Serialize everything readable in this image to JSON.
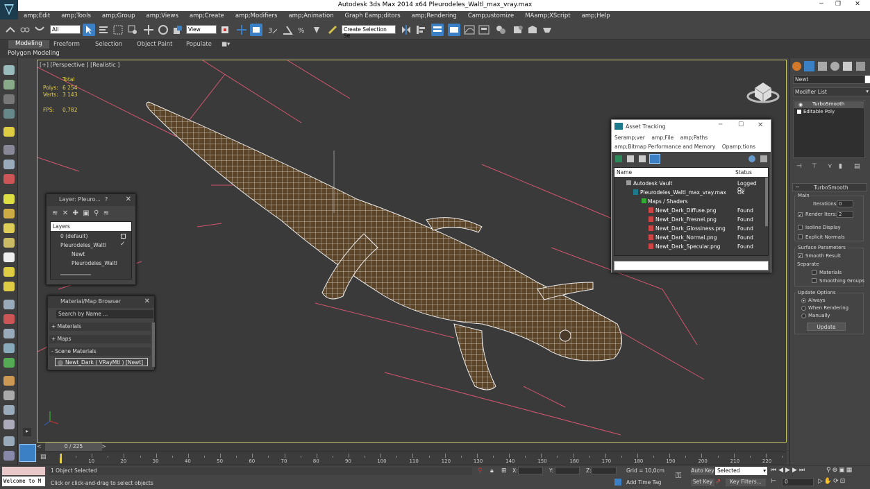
{
  "window": {
    "title": "Autodesk 3ds Max  2014 x64     Pleurodeles_Waltl_max_vray.max"
  },
  "menu": [
    "amp;Edit",
    "amp;Tools",
    "amp;Group",
    "amp;Views",
    "amp;Create",
    "amp;Modifiers",
    "amp;Animation",
    "Graph Eamp;ditors",
    "amp;Rendering",
    "Camp;ustomize",
    "MAamp;XScript",
    "amp;Help"
  ],
  "toolbar": {
    "filter_value": "All",
    "coord_value": "View",
    "selection_set_placeholder": "Create Selection Se"
  },
  "ribbon": {
    "tabs": [
      "Modeling",
      "Freeform",
      "Selection",
      "Object Paint",
      "Populate"
    ],
    "sub_label": "Polygon Modeling"
  },
  "viewport": {
    "label": "[+] [Perspective ] [Realistic ]",
    "stats": {
      "total_label": "Total",
      "polys_label": "Polys:",
      "polys_value": "6 254",
      "verts_label": "Verts:",
      "verts_value": "3 143",
      "fps_label": "FPS:",
      "fps_value": "0,782"
    }
  },
  "layer_dialog": {
    "title": "Layer: Pleuro...",
    "help": "?",
    "column": "Layers",
    "rows": [
      "0 (default)",
      "Pleurodeles_Waltl",
      "Newt",
      "Pleurodeles_Waltl"
    ]
  },
  "material_browser": {
    "title": "Material/Map Browser",
    "search_placeholder": "Search by Name ...",
    "sections": [
      "+ Materials",
      "+ Maps",
      "- Scene Materials"
    ],
    "scene_material": "Newt_Dark ( VRayMtl ) [Newt]"
  },
  "asset_tracking": {
    "title": "Asset Tracking",
    "menu1": [
      "Seramp;ver",
      "amp;File",
      "amp;Paths"
    ],
    "menu2": [
      "amp;Bitmap Performance and Memory",
      "Opamp;tions"
    ],
    "columns": [
      "Name",
      "Status"
    ],
    "rows": [
      {
        "name": "Autodesk Vault",
        "status": "Logged Ou"
      },
      {
        "name": "Pleurodeles_Waltl_max_vray.max",
        "status": "Ok"
      },
      {
        "name": "Maps / Shaders",
        "status": ""
      },
      {
        "name": "Newt_Dark_Diffuse.png",
        "status": "Found"
      },
      {
        "name": "Newt_Dark_Fresnel.png",
        "status": "Found"
      },
      {
        "name": "Newt_Dark_Glossiness.png",
        "status": "Found"
      },
      {
        "name": "Newt_Dark_Normal.png",
        "status": "Found"
      },
      {
        "name": "Newt_Dark_Specular.png",
        "status": "Found"
      }
    ]
  },
  "command_panel": {
    "object_name": "Newt",
    "modifier_list": "Modifier List",
    "stack": [
      "TurboSmooth",
      "Editable Poly"
    ],
    "rollout_title": "TurboSmooth",
    "main_label": "Main",
    "iterations_label": "Iterations:",
    "iterations_value": "0",
    "render_iters_label": "Render Iters:",
    "render_iters_value": "2",
    "isoline": "Isoline Display",
    "explicit": "Explicit Normals",
    "surface_label": "Surface Parameters",
    "smooth_result": "Smooth Result",
    "separate_label": "Separate",
    "materials": "Materials",
    "smoothing_groups": "Smoothing Groups",
    "update_label": "Update Options",
    "always": "Always",
    "when_rendering": "When Rendering",
    "manually": "Manually",
    "update_button": "Update"
  },
  "timeline": {
    "frame": "0 / 225",
    "ticks": [
      "10",
      "20",
      "30",
      "40",
      "50",
      "60",
      "70",
      "80",
      "90",
      "100",
      "110",
      "120",
      "130",
      "140",
      "150",
      "160",
      "170",
      "180",
      "190",
      "200",
      "210",
      "220"
    ]
  },
  "status": {
    "maxscript": "Welcome to M",
    "selected": "1 Object Selected",
    "prompt": "Click or click-and-drag to select objects",
    "x_label": "X:",
    "y_label": "Y:",
    "z_label": "Z:",
    "grid": "Grid = 10,0cm",
    "add_time_tag": "Add Time Tag",
    "auto_key": "Auto Key",
    "auto_key_value": "Selected",
    "set_key": "Set Key",
    "key_filters": "Key Filters...",
    "frame_value": "0"
  },
  "colors": {
    "viewport_border": "#c7c76a",
    "stat_yellow": "#e8d24a",
    "accent_blue": "#3b7fc4",
    "grid_pink": "#d4566f"
  }
}
